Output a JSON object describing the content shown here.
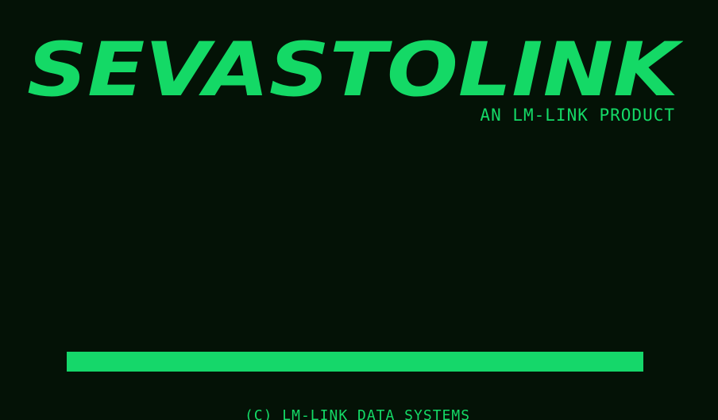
{
  "app": {
    "title": "SEVASTOLINK",
    "subtitle": "AN LM-LINK PRODUCT",
    "footer": "(C) LM-LINK DATA SYSTEMS"
  },
  "loading": {
    "progress": 1.0
  },
  "colors": {
    "background": "#041206",
    "accent": "#14d966"
  }
}
